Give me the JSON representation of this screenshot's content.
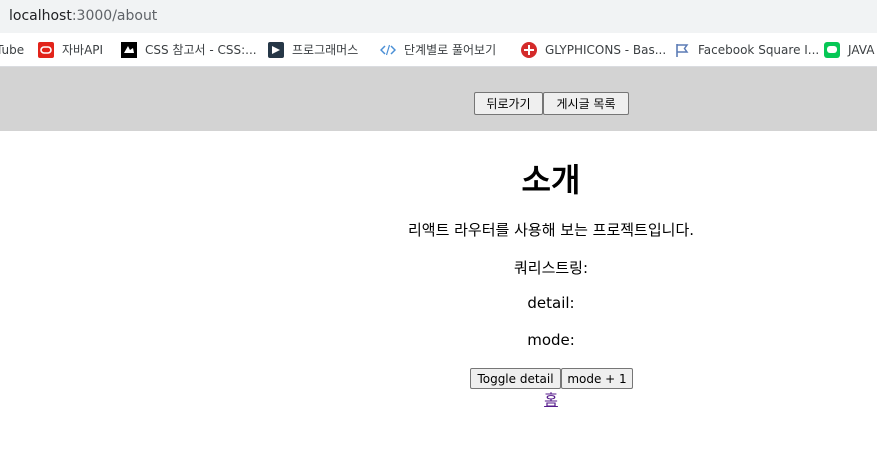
{
  "browser": {
    "url_host": "localhost",
    "url_path": ":3000/about"
  },
  "bookmarks": [
    {
      "label": "Tube",
      "icon": "youtube-icon"
    },
    {
      "label": "자바API",
      "icon": "oracle-icon",
      "color": "#e2231a"
    },
    {
      "label": "CSS 참고서 - CSS:...",
      "icon": "mdn-icon",
      "color": "#000000"
    },
    {
      "label": "프로그래머스",
      "icon": "programmers-icon",
      "color": "#263747"
    },
    {
      "label": "단계별로 풀어보기",
      "icon": "code-icon",
      "color": "#4a8fd6"
    },
    {
      "label": "GLYPHICONS - Bas...",
      "icon": "glyphicons-icon",
      "color": "#d42b2b"
    },
    {
      "label": "Facebook Square I...",
      "icon": "flag-icon",
      "color": "#5b7bb5"
    },
    {
      "label": "JAVA",
      "icon": "line-icon",
      "color": "#06c755"
    }
  ],
  "nav": {
    "back_label": "뒤로가기",
    "articles_label": "게시글 목록"
  },
  "main": {
    "title": "소개",
    "description": "리액트 라우터를 사용해 보는 프로젝트입니다.",
    "query_label": "쿼리스트링:",
    "detail_label": "detail:",
    "mode_label": "mode:",
    "toggle_detail_label": "Toggle detail",
    "mode_plus_label": "mode + 1",
    "home_link": "홈"
  },
  "colors": {
    "nav_background": "#d3d3d3",
    "visited_link": "#551a8b"
  }
}
